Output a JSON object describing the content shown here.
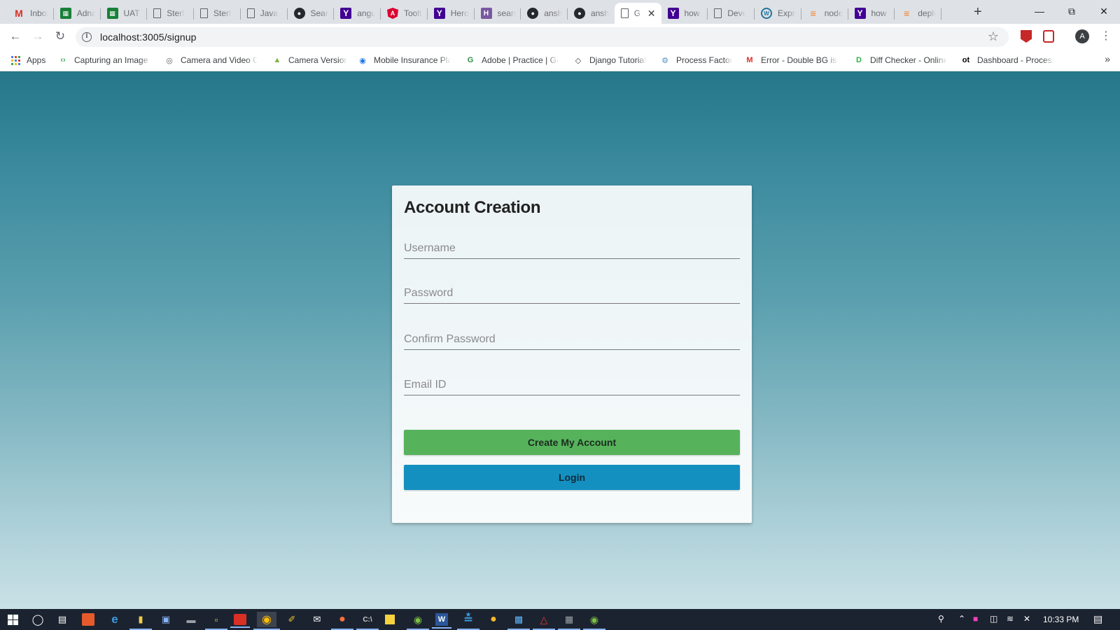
{
  "browser": {
    "tabs": [
      {
        "label": "Inbox",
        "icon": "gmail-icon"
      },
      {
        "label": "Adna",
        "icon": "sheets-icon"
      },
      {
        "label": "UAT T",
        "icon": "sheets-icon"
      },
      {
        "label": "Sterli",
        "icon": "document-icon"
      },
      {
        "label": "Sterlin",
        "icon": "document-icon"
      },
      {
        "label": "JavaS",
        "icon": "document-icon"
      },
      {
        "label": "Searc",
        "icon": "github-icon"
      },
      {
        "label": "angul",
        "icon": "yahoo-icon"
      },
      {
        "label": "Toolt",
        "icon": "angular-icon"
      },
      {
        "label": "Hero",
        "icon": "yahoo-icon"
      },
      {
        "label": "searc",
        "icon": "heroku-icon"
      },
      {
        "label": "anshu",
        "icon": "github-icon"
      },
      {
        "label": "anshu",
        "icon": "github-icon"
      },
      {
        "label": "G",
        "icon": "document-icon",
        "active": true
      },
      {
        "label": "how",
        "icon": "yahoo-icon"
      },
      {
        "label": "Deve",
        "icon": "document-icon"
      },
      {
        "label": "Expre",
        "icon": "wordpress-icon"
      },
      {
        "label": "node",
        "icon": "stackoverflow-icon"
      },
      {
        "label": "how",
        "icon": "yahoo-icon"
      },
      {
        "label": "deplo",
        "icon": "stackoverflow-icon"
      }
    ],
    "url": "localhost:3005/signup",
    "profile_initial": "A"
  },
  "bookmarks": [
    {
      "label": "Apps",
      "icon": "apps-grid-icon"
    },
    {
      "label": "Capturing an Image f",
      "icon": "code-icon"
    },
    {
      "label": "Camera and Video C",
      "icon": "camera-icon"
    },
    {
      "label": "Camera Version",
      "icon": "android-icon"
    },
    {
      "label": "Mobile Insurance Pla",
      "icon": "eye-icon"
    },
    {
      "label": "Adobe | Practice | Ge",
      "icon": "geeksforgeeks-icon"
    },
    {
      "label": "Django Tutorial",
      "icon": "django-icon"
    },
    {
      "label": "Process Factory",
      "icon": "gears-icon"
    },
    {
      "label": "Error - Double BG iss",
      "icon": "gmail-icon"
    },
    {
      "label": "Diff Checker - Online",
      "icon": "diffchecker-icon"
    },
    {
      "label": "Dashboard - Process",
      "icon": "ot-icon"
    }
  ],
  "signup": {
    "title": "Account Creation",
    "username_placeholder": "Username",
    "password_placeholder": "Password",
    "confirm_placeholder": "Confirm Password",
    "email_placeholder": "Email ID",
    "create_label": "Create My Account",
    "login_label": "Login"
  },
  "taskbar": {
    "clock": "10:33 PM"
  },
  "colors": {
    "create_button": "#56b35c",
    "login_button": "#1490c0",
    "page_gradient_top": "#257789",
    "page_gradient_bottom": "#c9e1e6"
  }
}
